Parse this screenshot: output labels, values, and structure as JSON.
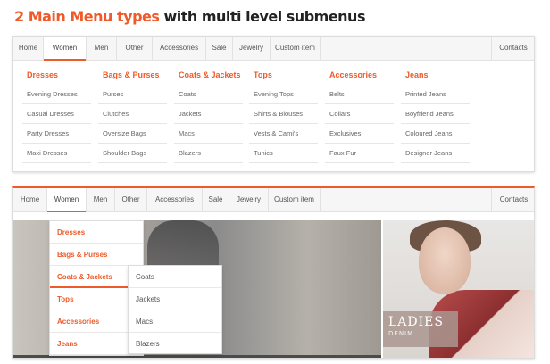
{
  "heading": {
    "accent": "2 Main Menu types",
    "rest": " with multi level submenus"
  },
  "menu": {
    "items": [
      "Home",
      "Women",
      "Men",
      "Other",
      "Accessories",
      "Sale",
      "Jewelry",
      "Custom item"
    ],
    "contacts": "Contacts",
    "active": "Women"
  },
  "mega": {
    "columns": [
      {
        "title": "Dresses",
        "links": [
          "Evening Dresses",
          "Casual Dresses",
          "Party Dresses",
          "Maxi Dresses"
        ]
      },
      {
        "title": "Bags & Purses",
        "links": [
          "Purses",
          "Clutches",
          "Oversize Bags",
          "Shoulder Bags"
        ]
      },
      {
        "title": "Coats & Jackets",
        "links": [
          "Coats",
          "Jackets",
          "Macs",
          "Blazers"
        ]
      },
      {
        "title": "Tops",
        "links": [
          "Evening Tops",
          "Shirts & Blouses",
          "Vests & Cami's",
          "Tunics"
        ]
      },
      {
        "title": "Accessories",
        "links": [
          "Belts",
          "Collars",
          "Exclusives",
          "Faux Fur"
        ]
      },
      {
        "title": "Jeans",
        "links": [
          "Printed Jeans",
          "Boyfriend Jeans",
          "Coloured Jeans",
          "Designer Jeans"
        ]
      }
    ]
  },
  "dropdown": {
    "level1": [
      "Dresses",
      "Bags & Purses",
      "Coats & Jackets",
      "Tops",
      "Accessories",
      "Jeans"
    ],
    "level2": [
      "Coats",
      "Jackets",
      "Macs",
      "Blazers"
    ]
  },
  "promo": {
    "line1": "LADIES",
    "line2": "DENIM"
  },
  "colors": {
    "accent": "#ee5a2a",
    "menu_bg": "#f6f6f6",
    "border": "#e2e2e2"
  }
}
